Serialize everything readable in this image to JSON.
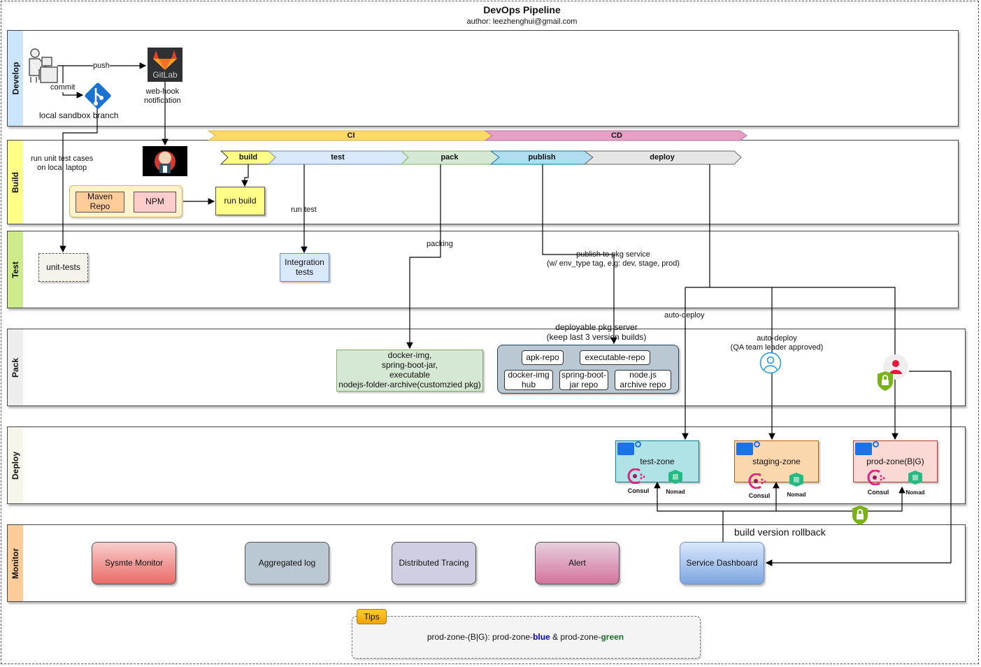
{
  "header": {
    "title": "DevOps Pipeline",
    "author": "author: leezhenghui@gmail.com"
  },
  "lanes": [
    {
      "label": "Develop",
      "color": "#cce5ff"
    },
    {
      "label": "Build",
      "color": "#ffff88"
    },
    {
      "label": "Test",
      "color": "#cdeb8b"
    },
    {
      "label": "Pack",
      "color": "#eeeeee"
    },
    {
      "label": "Deploy",
      "color": "#f5f5ea"
    },
    {
      "label": "Monitor",
      "color": "#ffcc99"
    }
  ],
  "develop": {
    "push_label": "push",
    "commit_label": "commit",
    "branch_label": "local sandbox branch",
    "gitlab_text": "GitLab",
    "webhook_label": "web-hook\nnotification",
    "icons": [
      "developer-icon",
      "git-icon",
      "gitlab-icon"
    ]
  },
  "phases": {
    "ci": "CI",
    "cd": "CD"
  },
  "stages": [
    {
      "label": "build",
      "color": "#ffff88"
    },
    {
      "label": "test",
      "color": "#dae8fc"
    },
    {
      "label": "pack",
      "color": "#d5e8d4"
    },
    {
      "label": "publish",
      "color": "#b1ddf0"
    },
    {
      "label": "deploy",
      "color": "#e6e6e6"
    }
  ],
  "build": {
    "unit_note": "run unit test cases\non local laptop",
    "maven": "Maven\nRepo",
    "npm": "NPM",
    "run_build": "run build",
    "jenkins_icon": "jenkins-icon"
  },
  "test": {
    "unit_tests": "unit-tests",
    "integration_tests": "Integration\ntests",
    "run_test_label": "run test",
    "packing_label": "packing",
    "publish_label": "publish to pkg service\n(w/ env_type tag, e.g: dev, stage, prod)"
  },
  "pack": {
    "artifacts": "docker-img,\nspring-boot-jar,\nexecutable\nnodejs-folder-archive(customzied pkg)",
    "server_title": "deployable pkg server\n(keep last 3 version builds)",
    "repos": [
      "apk-repo",
      "executable-repo",
      "docker-img\nhub",
      "spring-boot-\njar repo",
      "node.js\narchive repo"
    ],
    "auto_deploy_label": "auto-deploy",
    "qa_auto_deploy_label": "auto-deploy\n(QA team leader approved)"
  },
  "deploy": {
    "zones": [
      {
        "name": "test-zone",
        "fill": "#b0e3e6",
        "stroke": "#0e8088"
      },
      {
        "name": "staging-zone",
        "fill": "#fad7ac",
        "stroke": "#b46504"
      },
      {
        "name": "prod-zone(B|G)",
        "fill": "#fad9d5",
        "stroke": "#ae4132"
      }
    ],
    "consul_label": "Consul",
    "nomad_label": "Nomad"
  },
  "monitor": {
    "rollback_label": "build version rollback",
    "boxes": [
      {
        "label": "Sysmte Monitor",
        "top": "#f8cecc",
        "bottom": "#ea6b66"
      },
      {
        "label": "Aggregated log",
        "top": "#bac8d3",
        "bottom": "#bac8d3"
      },
      {
        "label": "Distributed Tracing",
        "top": "#d0cee2",
        "bottom": "#d0cee2"
      },
      {
        "label": "Alert",
        "top": "#e6d0de",
        "bottom": "#d5739d"
      },
      {
        "label": "Service Dashboard",
        "top": "#dae8fc",
        "bottom": "#7ea6e0"
      }
    ]
  },
  "tips": {
    "tag": "Tips",
    "prefix": "prod-zone-(B|G):  prod-zone-",
    "blue": "blue",
    "middle": " & prod-zone-",
    "green": "green"
  }
}
